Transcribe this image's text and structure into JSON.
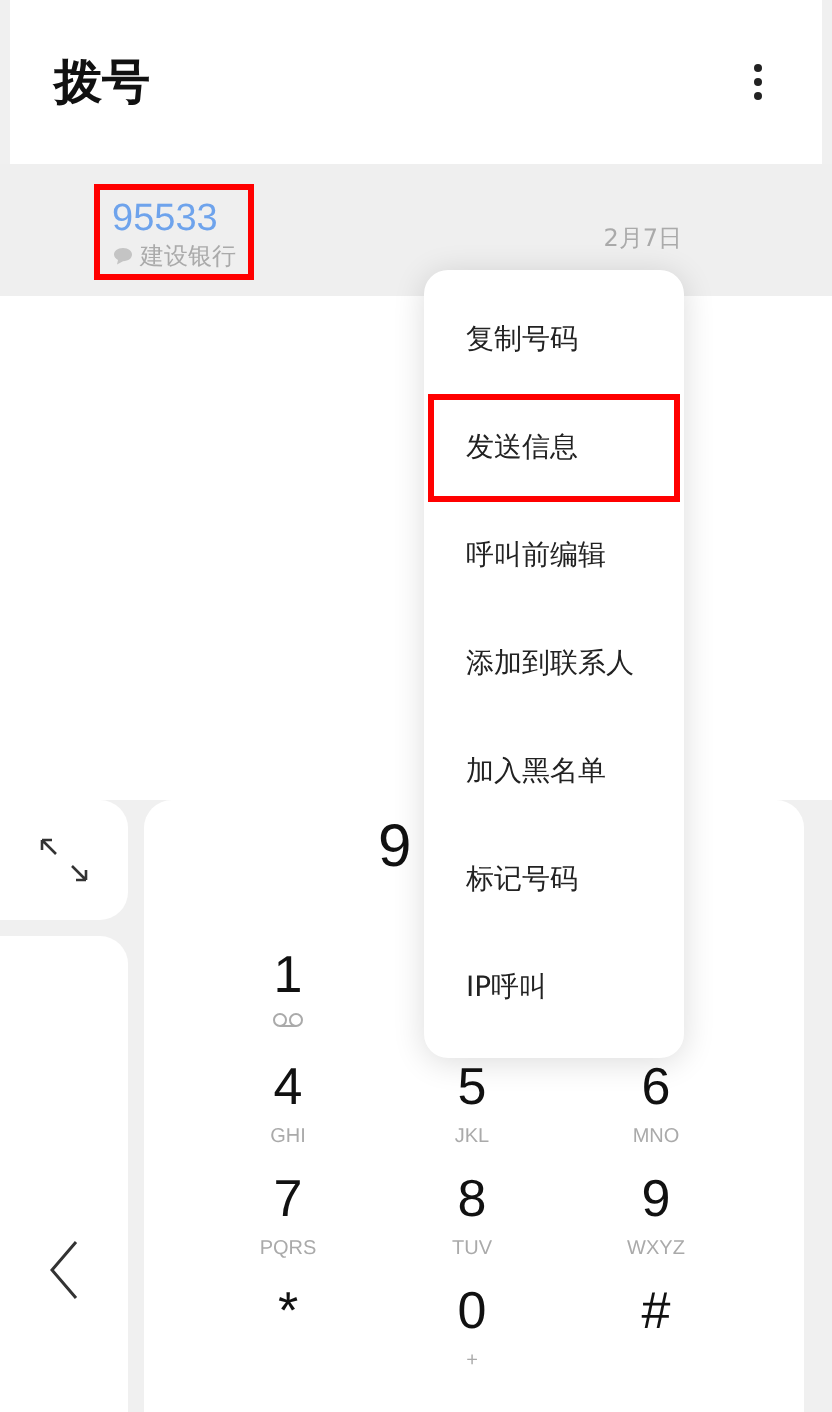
{
  "header": {
    "title": "拨号"
  },
  "call_log": [
    {
      "number": "95533",
      "label": "建设银行",
      "date": "2月7日",
      "highlighted": true
    }
  ],
  "dial_display": {
    "number": "9"
  },
  "menu": [
    {
      "label": "复制号码",
      "highlighted": false
    },
    {
      "label": "发送信息",
      "highlighted": true
    },
    {
      "label": "呼叫前编辑",
      "highlighted": false
    },
    {
      "label": "添加到联系人",
      "highlighted": false
    },
    {
      "label": "加入黑名单",
      "highlighted": false
    },
    {
      "label": "标记号码",
      "highlighted": false
    },
    {
      "label": "IP呼叫",
      "highlighted": false
    }
  ],
  "keypad": [
    [
      {
        "digit": "1",
        "kind": "voicemail"
      }
    ],
    [
      {
        "digit": "4",
        "kind": "letters",
        "letters": "GHI"
      },
      {
        "digit": "5",
        "kind": "letters",
        "letters": "JKL"
      },
      {
        "digit": "6",
        "kind": "letters",
        "letters": "MNO"
      }
    ],
    [
      {
        "digit": "7",
        "kind": "letters",
        "letters": "PQRS"
      },
      {
        "digit": "8",
        "kind": "letters",
        "letters": "TUV"
      },
      {
        "digit": "9",
        "kind": "letters",
        "letters": "WXYZ"
      }
    ],
    [
      {
        "digit": "*",
        "kind": "plain"
      },
      {
        "digit": "0",
        "kind": "letters",
        "letters": "+"
      },
      {
        "digit": "#",
        "kind": "plain"
      }
    ]
  ]
}
